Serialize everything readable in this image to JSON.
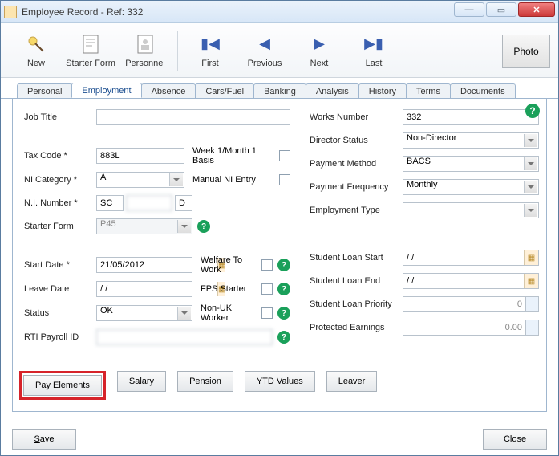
{
  "window": {
    "title": "Employee Record - Ref: 332"
  },
  "toolbar": {
    "new": "New",
    "starter_form": "Starter Form",
    "personnel": "Personnel",
    "first": "First",
    "previous": "Previous",
    "next": "Next",
    "last": "Last",
    "photo": "Photo"
  },
  "tabs": {
    "personal": "Personal",
    "employment": "Employment",
    "absence": "Absence",
    "cars_fuel": "Cars/Fuel",
    "banking": "Banking",
    "analysis": "Analysis",
    "history": "History",
    "terms": "Terms",
    "documents": "Documents"
  },
  "left": {
    "job_title_label": "Job Title",
    "job_title": "",
    "tax_code_label": "Tax Code *",
    "tax_code": "883L",
    "week1_label": "Week 1/Month 1 Basis",
    "ni_category_label": "NI Category *",
    "ni_category": "A",
    "manual_ni_label": "Manual NI Entry",
    "ni_number_label": "N.I. Number *",
    "ni_prefix": "SC",
    "ni_mid": "",
    "ni_suffix": "D",
    "starter_form_label": "Starter Form",
    "starter_form": "P45",
    "start_date_label": "Start Date *",
    "start_date": "21/05/2012",
    "welfare_label": "Welfare To Work",
    "leave_date_label": "Leave Date",
    "leave_date": "/ /",
    "fps_label": "FPS Starter",
    "status_label": "Status",
    "status": "OK",
    "nonuk_label": "Non-UK Worker",
    "rti_label": "RTI Payroll ID",
    "rti": ""
  },
  "right": {
    "works_no_label": "Works Number",
    "works_no": "332",
    "director_label": "Director Status",
    "director": "Non-Director",
    "pay_method_label": "Payment Method",
    "pay_method": "BACS",
    "pay_freq_label": "Payment Frequency",
    "pay_freq": "Monthly",
    "emp_type_label": "Employment Type",
    "emp_type": "",
    "loan_start_label": "Student Loan Start",
    "loan_start": "/ /",
    "loan_end_label": "Student Loan End",
    "loan_end": "/ /",
    "loan_priority_label": "Student Loan Priority",
    "loan_priority": "0",
    "protected_label": "Protected Earnings",
    "protected": "0.00"
  },
  "buttons": {
    "pay_elements": "Pay Elements",
    "salary": "Salary",
    "pension": "Pension",
    "ytd": "YTD Values",
    "leaver": "Leaver",
    "save": "Save",
    "close": "Close"
  }
}
